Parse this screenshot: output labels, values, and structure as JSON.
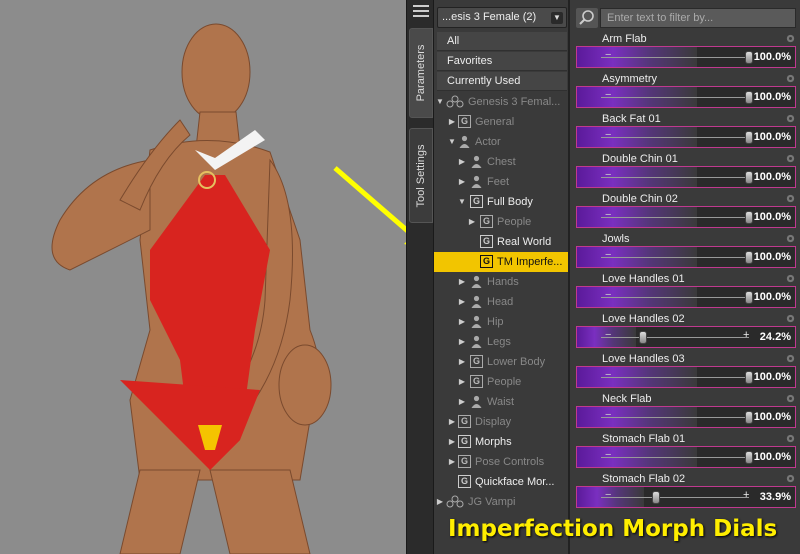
{
  "tabs": [
    {
      "label": "Parameters",
      "active": true
    },
    {
      "label": "Tool Settings",
      "active": false
    }
  ],
  "tree": {
    "figure_selector": "...esis 3 Female (2)",
    "filters": [
      "All",
      "Favorites",
      "Currently Used"
    ],
    "items": [
      {
        "label": "Genesis 3 Femal...",
        "depth": 0,
        "expander": "down",
        "icon": "figure-icon",
        "dim": true,
        "selected": false
      },
      {
        "label": "General",
        "depth": 1,
        "expander": "right",
        "icon": "group-icon",
        "dim": true,
        "selected": false
      },
      {
        "label": "Actor",
        "depth": 1,
        "expander": "down",
        "icon": "person-icon",
        "dim": true,
        "selected": false
      },
      {
        "label": "Chest",
        "depth": 2,
        "expander": "right",
        "icon": "person-icon",
        "dim": true,
        "selected": false
      },
      {
        "label": "Feet",
        "depth": 2,
        "expander": "right",
        "icon": "person-icon",
        "dim": true,
        "selected": false
      },
      {
        "label": "Full Body",
        "depth": 2,
        "expander": "down",
        "icon": "group-icon",
        "dim": false,
        "selected": false
      },
      {
        "label": "People",
        "depth": 3,
        "expander": "right",
        "icon": "group-icon",
        "dim": true,
        "selected": false
      },
      {
        "label": "Real World",
        "depth": 3,
        "expander": "",
        "icon": "group-icon",
        "dim": false,
        "selected": false
      },
      {
        "label": "TM Imperfe...",
        "depth": 3,
        "expander": "",
        "icon": "group-icon",
        "dim": false,
        "selected": true
      },
      {
        "label": "Hands",
        "depth": 2,
        "expander": "right",
        "icon": "person-icon",
        "dim": true,
        "selected": false
      },
      {
        "label": "Head",
        "depth": 2,
        "expander": "right",
        "icon": "person-icon",
        "dim": true,
        "selected": false
      },
      {
        "label": "Hip",
        "depth": 2,
        "expander": "right",
        "icon": "person-icon",
        "dim": true,
        "selected": false
      },
      {
        "label": "Legs",
        "depth": 2,
        "expander": "right",
        "icon": "person-icon",
        "dim": true,
        "selected": false
      },
      {
        "label": "Lower Body",
        "depth": 2,
        "expander": "right",
        "icon": "group-icon",
        "dim": true,
        "selected": false
      },
      {
        "label": "People",
        "depth": 2,
        "expander": "right",
        "icon": "group-icon",
        "dim": true,
        "selected": false
      },
      {
        "label": "Waist",
        "depth": 2,
        "expander": "right",
        "icon": "person-icon",
        "dim": true,
        "selected": false
      },
      {
        "label": "Display",
        "depth": 1,
        "expander": "right",
        "icon": "group-icon",
        "dim": true,
        "selected": false
      },
      {
        "label": "Morphs",
        "depth": 1,
        "expander": "right",
        "icon": "group-icon",
        "dim": false,
        "selected": false
      },
      {
        "label": "Pose Controls",
        "depth": 1,
        "expander": "right",
        "icon": "group-icon",
        "dim": true,
        "selected": false
      },
      {
        "label": "Quickface Mor...",
        "depth": 1,
        "expander": "",
        "icon": "group-icon",
        "dim": false,
        "selected": false
      },
      {
        "label": "JG Vampi",
        "depth": 0,
        "expander": "right",
        "icon": "figure-icon",
        "dim": true,
        "selected": false
      }
    ]
  },
  "search": {
    "placeholder": "Enter text to filter by..."
  },
  "dials": [
    {
      "name": "Arm Flab",
      "value": "100.0%",
      "level": 1.0
    },
    {
      "name": "Asymmetry",
      "value": "100.0%",
      "level": 1.0
    },
    {
      "name": "Back Fat 01",
      "value": "100.0%",
      "level": 1.0
    },
    {
      "name": "Double Chin 01",
      "value": "100.0%",
      "level": 1.0
    },
    {
      "name": "Double Chin 02",
      "value": "100.0%",
      "level": 1.0
    },
    {
      "name": "Jowls",
      "value": "100.0%",
      "level": 1.0
    },
    {
      "name": "Love Handles 01",
      "value": "100.0%",
      "level": 1.0
    },
    {
      "name": "Love Handles 02",
      "value": "24.2%",
      "level": 0.242
    },
    {
      "name": "Love Handles 03",
      "value": "100.0%",
      "level": 1.0
    },
    {
      "name": "Neck Flab",
      "value": "100.0%",
      "level": 1.0
    },
    {
      "name": "Stomach Flab 01",
      "value": "100.0%",
      "level": 1.0
    },
    {
      "name": "Stomach Flab 02",
      "value": "33.9%",
      "level": 0.339
    }
  ],
  "caption": "Imperfection Morph Dials",
  "colors": {
    "selection": "#f2c500",
    "dial_border": "#c0398f",
    "dial_fill": "#6a25b0",
    "caption": "#ffee00",
    "annotation_arrow": "#ffff00"
  }
}
